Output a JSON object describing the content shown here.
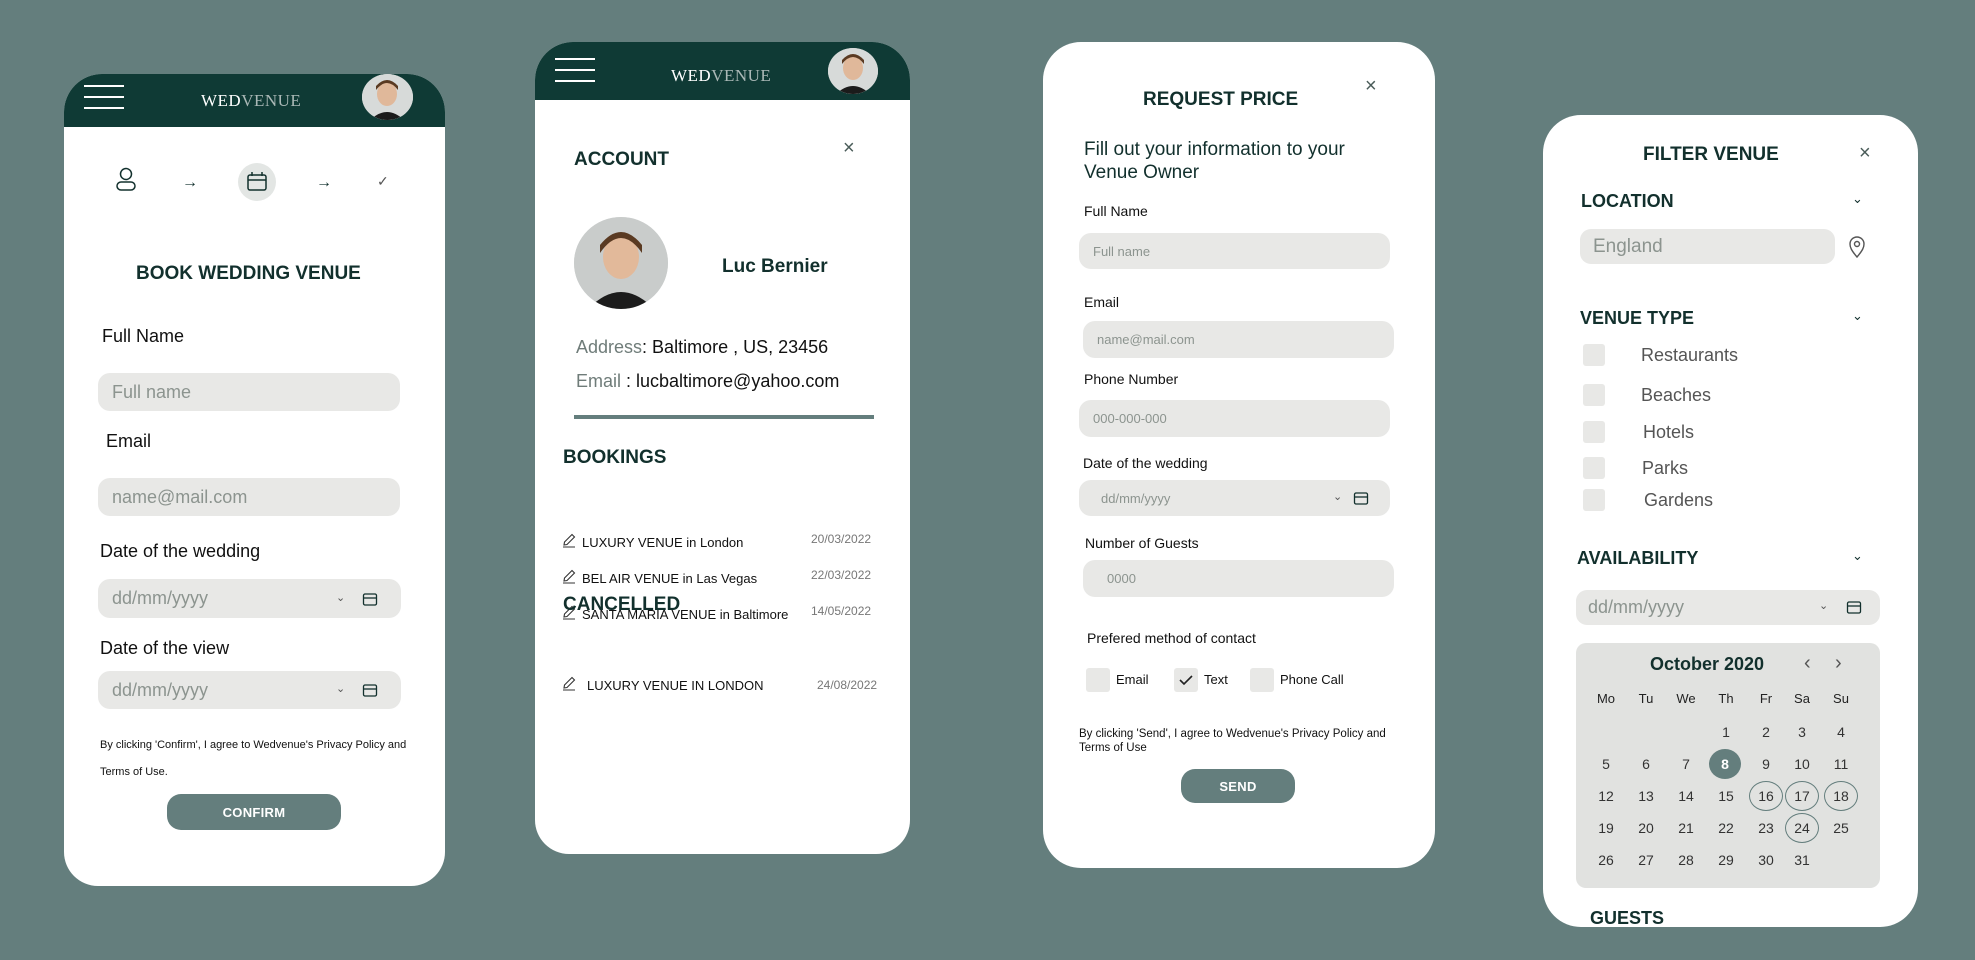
{
  "brand": {
    "wed": "WED",
    "venue": "VENUE"
  },
  "book": {
    "title": "BOOK WEDDING VENUE",
    "full_name_label": "Full Name",
    "full_name_placeholder": "Full name",
    "email_label": "Email",
    "email_placeholder": "name@mail.com",
    "wedding_date_label": "Date of the wedding",
    "date_placeholder": "dd/mm/yyyy",
    "view_date_label": "Date of the view",
    "agree_line1": "By clicking 'Confirm', I agree to Wedvenue's Privacy Policy and",
    "agree_line2": "Terms of Use.",
    "confirm": "CONFIRM"
  },
  "account": {
    "title": "ACCOUNT",
    "name": "Luc Bernier",
    "address_label": "Address",
    "address_value": ": Baltimore , US, 23456",
    "email_label": "Email",
    "email_value": " : lucbaltimore@yahoo.com",
    "bookings_title": "BOOKINGS",
    "bookings": [
      {
        "name": "LUXURY VENUE in London",
        "date": "20/03/2022"
      },
      {
        "name": "BEL AIR VENUE in Las Vegas",
        "date": "22/03/2022"
      },
      {
        "name": "SANTA MARIA VENUE in Baltimore",
        "date": "14/05/2022"
      }
    ],
    "cancelled_title": "CANCELLED",
    "cancelled": [
      {
        "name": "LUXURY VENUE IN LONDON",
        "date": "24/08/2022"
      }
    ]
  },
  "request": {
    "title": "REQUEST PRICE",
    "subtitle_line1": "Fill out your information to your",
    "subtitle_line2": "Venue Owner",
    "full_name_label": "Full Name",
    "full_name_placeholder": "Full name",
    "email_label": "Email",
    "email_placeholder": "name@mail.com",
    "phone_label": "Phone Number",
    "phone_placeholder": "000-000-000",
    "date_label": "Date of the wedding",
    "date_placeholder": "dd/mm/yyyy",
    "guests_label": "Number of Guests",
    "guests_placeholder": "0000",
    "contact_label": "Prefered method of contact",
    "contact_options": [
      {
        "label": "Email",
        "checked": false
      },
      {
        "label": "Text",
        "checked": true
      },
      {
        "label": "Phone Call",
        "checked": false
      }
    ],
    "agree_line1": "By clicking 'Send', I agree to Wedvenue's Privacy Policy and",
    "agree_line2": "Terms of Use",
    "send": "SEND"
  },
  "filter": {
    "title": "FILTER VENUE",
    "location_title": "LOCATION",
    "location_value": "England",
    "venue_type_title": "VENUE TYPE",
    "venue_types": [
      "Restaurants",
      "Beaches",
      "Hotels",
      "Parks",
      "Gardens"
    ],
    "availability_title": "AVAILABILITY",
    "date_placeholder": "dd/mm/yyyy",
    "calendar": {
      "month": "October 2020",
      "weekdays": [
        "Mo",
        "Tu",
        "We",
        "Th",
        "Fr",
        "Sa",
        "Su"
      ],
      "weeks": [
        [
          "",
          "",
          "",
          "1",
          "2",
          "3",
          "4"
        ],
        [
          "5",
          "6",
          "7",
          "8",
          "9",
          "10",
          "11"
        ],
        [
          "12",
          "13",
          "14",
          "15",
          "16",
          "17",
          "18"
        ],
        [
          "19",
          "20",
          "21",
          "22",
          "23",
          "24",
          "25"
        ],
        [
          "26",
          "27",
          "28",
          "29",
          "30",
          "31",
          ""
        ]
      ],
      "selected": "8",
      "ringed": [
        "16",
        "17",
        "18",
        "24"
      ]
    },
    "guests_title": "GUESTS"
  },
  "colors": {
    "background": "#647e7d",
    "header": "#0f3a35",
    "accent": "#647e7d",
    "field": "#e8e8e6"
  }
}
